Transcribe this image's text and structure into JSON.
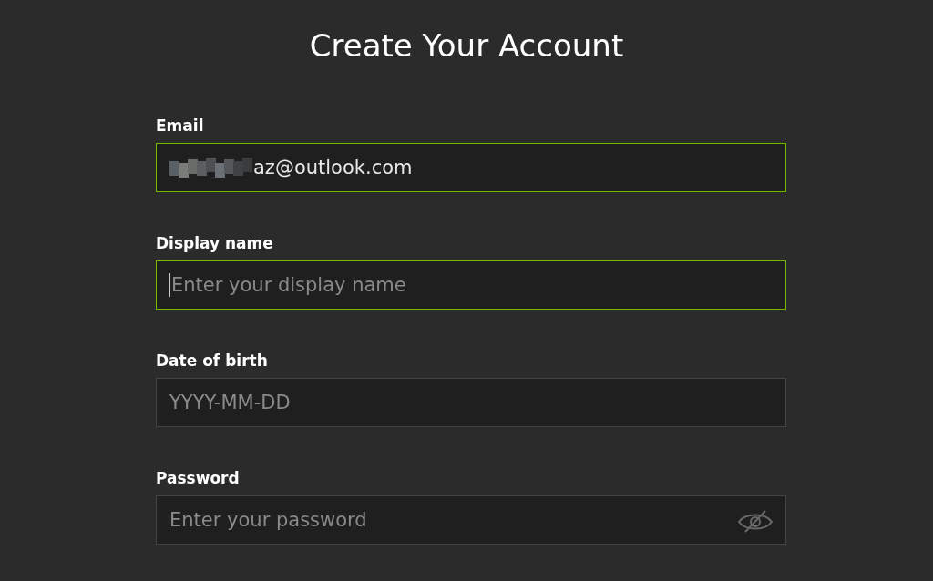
{
  "title": "Create Your Account",
  "fields": [
    {
      "label": "Email",
      "kind": "text",
      "value": "az@outlook.com",
      "redacted": true,
      "highlighted": true,
      "focused": false
    },
    {
      "label": "Display name",
      "kind": "text",
      "placeholder": "Enter your display name",
      "highlighted": true,
      "focused": true
    },
    {
      "label": "Date of birth",
      "kind": "text",
      "placeholder": "YYYY-MM-DD",
      "highlighted": false,
      "focused": false
    },
    {
      "label": "Password",
      "kind": "password",
      "placeholder": "Enter your password",
      "highlighted": false,
      "focused": false
    }
  ]
}
